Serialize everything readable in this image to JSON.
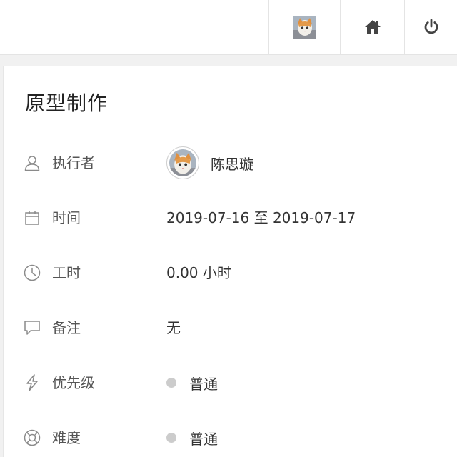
{
  "topbar": {
    "avatar_icon": "user-avatar-icon",
    "home_icon": "home-icon",
    "power_icon": "power-icon"
  },
  "task": {
    "title": "原型制作",
    "fields": {
      "assignee": {
        "label": "执行者",
        "icon": "user-icon",
        "name": "陈思璇"
      },
      "time": {
        "label": "时间",
        "icon": "calendar-icon",
        "value": "2019-07-16 至 2019-07-17"
      },
      "hours": {
        "label": "工时",
        "icon": "clock-icon",
        "value": "0.00 小时"
      },
      "note": {
        "label": "备注",
        "icon": "comment-icon",
        "value": "无"
      },
      "priority": {
        "label": "优先级",
        "icon": "lightning-icon",
        "value": "普通",
        "dot_color": "#cccccc"
      },
      "difficulty": {
        "label": "难度",
        "icon": "lifebuoy-icon",
        "value": "普通",
        "dot_color": "#cccccc"
      }
    }
  },
  "colors": {
    "background": "#f1f1f1",
    "panel": "#ffffff",
    "icon_gray": "#8a8a8a",
    "text_dark": "#333333"
  }
}
